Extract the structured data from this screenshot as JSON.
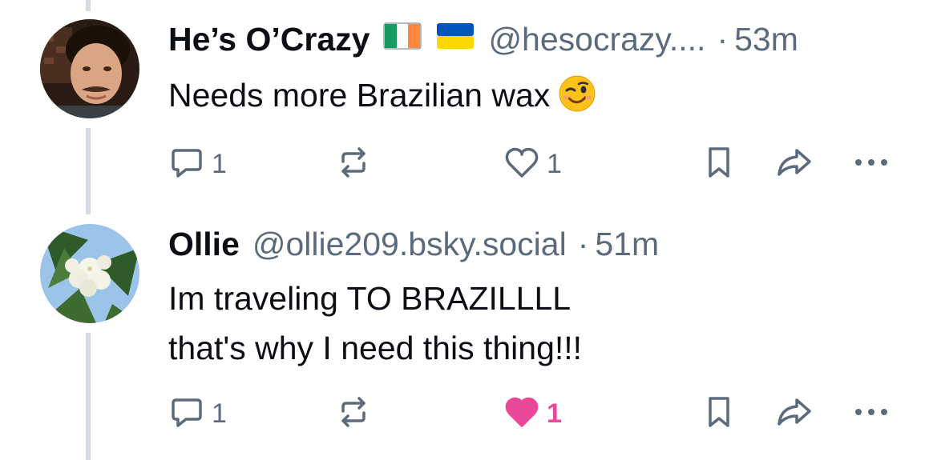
{
  "posts": [
    {
      "display_name": "He’s O’Crazy",
      "flags": [
        "ireland-flag",
        "ukraine-flag"
      ],
      "handle": "@hesocrazy....",
      "separator": "·",
      "time": "53m",
      "text_lines": [
        "Needs more Brazilian wax"
      ],
      "emoji": "winking-face-emoji",
      "replies": "1",
      "reposts": "",
      "likes": "1",
      "liked": false
    },
    {
      "display_name": "Ollie",
      "flags": [],
      "handle": "@ollie209.bsky.social",
      "separator": "·",
      "time": "51m",
      "text_lines": [
        "Im traveling TO BRAZILLLL",
        "that's why I need this thing!!!"
      ],
      "replies": "1",
      "reposts": "",
      "likes": "1",
      "liked": true
    }
  ],
  "colors": {
    "muted": "#5b6b7c",
    "like_active": "#ec4899",
    "thread_line": "#d4dbe2"
  }
}
